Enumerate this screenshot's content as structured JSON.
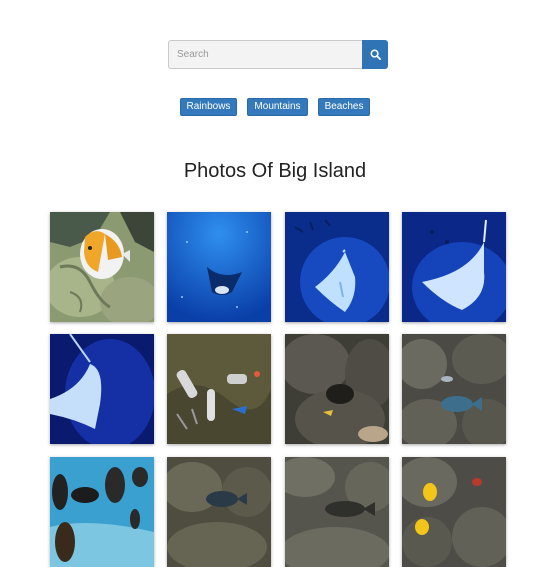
{
  "search": {
    "placeholder": "Search",
    "button_icon": "search-icon"
  },
  "tags": [
    "Rainbows",
    "Mountains",
    "Beaches"
  ],
  "title": "Photos Of Big Island",
  "colors": {
    "accent": "#3479bb",
    "search_button": "#2f74b5"
  },
  "photos": [
    {
      "subject": "butterflyfish on coral"
    },
    {
      "subject": "manta ray in deep blue water"
    },
    {
      "subject": "manta ray lit from below"
    },
    {
      "subject": "manta ray turning"
    },
    {
      "subject": "manta ray wing close-up"
    },
    {
      "subject": "divers on the reef"
    },
    {
      "subject": "reef with small fish"
    },
    {
      "subject": "reef with blue fish"
    },
    {
      "subject": "black fish over bright reef"
    },
    {
      "subject": "fish over rocky reef"
    },
    {
      "subject": "fish on coral heads"
    },
    {
      "subject": "yellow tangs on reef"
    }
  ]
}
